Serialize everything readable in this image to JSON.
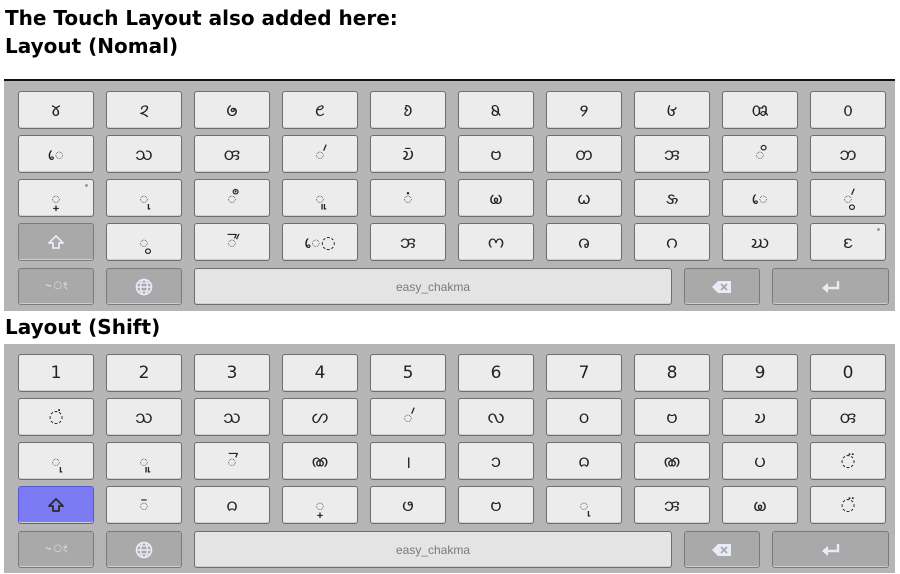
{
  "headings": {
    "intro": "The Touch Layout also added here:",
    "normal_title": "Layout (Nomal)",
    "shift_title": "Layout (Shift)"
  },
  "keyboards": [
    {
      "id": "normal",
      "shift_active": false,
      "rows": [
        [
          "𑄷",
          "𑄸",
          "𑄹",
          "𑄺",
          "𑄻",
          "𑄼",
          "𑄽",
          "𑄾",
          "𑄿",
          "𑄶"
        ],
        [
          "𑄬",
          "𑄥",
          "𑄢",
          "◌𑄧",
          "𑄌𑄴",
          "𑄝",
          "𑄖",
          "𑄞",
          "◌𑄨",
          "𑄃"
        ],
        [
          "◌𑄳",
          "◌𑄪",
          "◌𑄩",
          "◌𑄫",
          "◌𑄁",
          "𑄟",
          "𑄠",
          "𑄡",
          "◌𑄬",
          "◌𑄮"
        ],
        [
          "𑄱",
          "◌𑄰",
          "𑄬◌",
          "𑄞",
          "𑄇",
          "𑄈",
          "𑄉",
          "𑄊",
          "𑄋",
          "𑄴"
        ]
      ],
      "hint_dots": [
        [],
        [],
        [
          0
        ],
        [],
        [],
        [],
        [],
        [],
        [],
        []
      ],
      "hint_dots_row4_last": true,
      "bottom": {
        "lang_label": "~ং",
        "space_label": "easy_chakma"
      }
    },
    {
      "id": "shift",
      "shift_active": true,
      "rows": [
        [
          "1",
          "2",
          "3",
          "4",
          "5",
          "6",
          "7",
          "8",
          "9",
          "0"
        ],
        [
          "◌̇",
          "𑄥",
          "𑄥",
          "𑄦",
          "𑄧",
          "𑄣",
          "𑄤",
          "𑄝",
          "𑄌",
          "𑄢"
        ],
        [
          "◌𑄪",
          "◌𑄫",
          "◌𑄭",
          "𑄚",
          "।",
          "𑄘",
          "𑄙",
          "𑄚",
          "𑄛",
          "◌̈"
        ],
        [
          "𑄴",
          "𑄙",
          "◌𑄳",
          "𑄜",
          "𑄝",
          "◌𑄪",
          "𑄞",
          "𑄟",
          "◌̈"
        ]
      ],
      "bottom": {
        "lang_label": "~ং",
        "space_label": "easy_chakma"
      }
    }
  ],
  "colors": {
    "keyboard_bg": "#b5b5b5",
    "key_bg": "#ececec",
    "func_key_bg": "#a9a9a9",
    "shift_active_bg": "#7b7bf4"
  },
  "icons": {
    "shift": "shift-arrow-icon",
    "globe": "globe-icon",
    "backspace": "backspace-icon",
    "enter": "enter-icon"
  }
}
